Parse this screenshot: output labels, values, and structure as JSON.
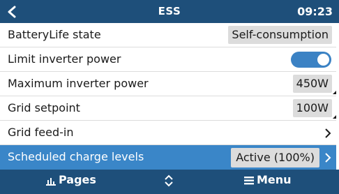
{
  "header": {
    "title": "ESS",
    "time": "09:23",
    "back_icon": "chevron-left-icon"
  },
  "rows": [
    {
      "label": "BatteryLife state",
      "value": "Self-consumption"
    },
    {
      "label": "Limit inverter power",
      "toggle": "on"
    },
    {
      "label": "Maximum inverter power",
      "value": "450W"
    },
    {
      "label": "Grid setpoint",
      "value": "100W"
    },
    {
      "label": "Grid feed-in",
      "icon": "chevron-right-icon"
    },
    {
      "label": "Scheduled charge levels",
      "value": "Active (100%)",
      "selected": true
    }
  ],
  "bottom_bar": {
    "pages_label": "Pages",
    "menu_label": "Menu",
    "pages_icon": "bar-chart-icon",
    "menu_icon": "hamburger-menu-icon",
    "center_icon": "up-down-arrows-icon"
  },
  "colors": {
    "header_bg": "#1e4f7a",
    "selected_row_bg": "#3a86c8",
    "toggle_on": "#3b82c4",
    "value_box_bg": "#dcdcdc"
  }
}
